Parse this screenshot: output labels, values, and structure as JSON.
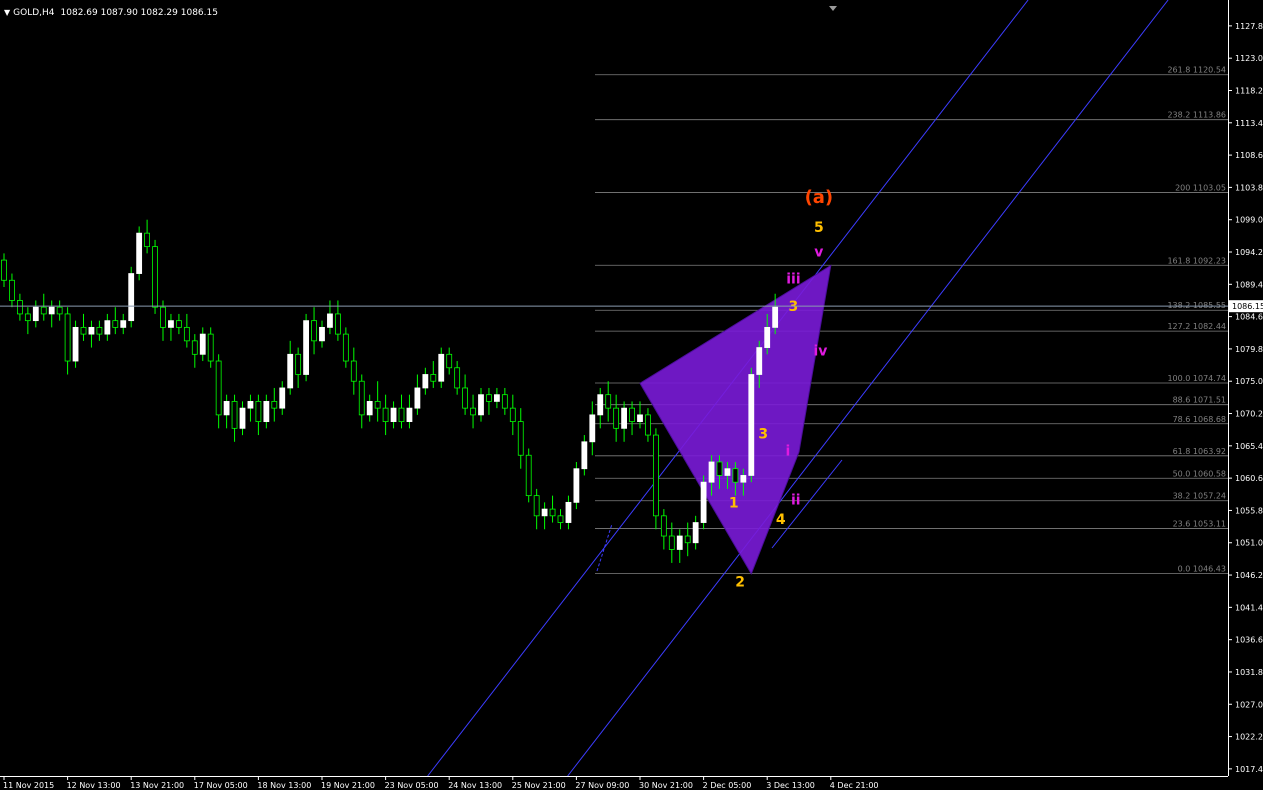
{
  "window": {
    "symbol_timeframe": "GOLD,H4",
    "ohlc": "1082.69 1087.90 1082.29 1086.15"
  },
  "colors": {
    "background": "#000000",
    "bull": "#ffffff",
    "wick_bull": "#00ff00",
    "bear": "#000000",
    "axis": "#ffffff",
    "grid_fib": "#808080",
    "channel": "#3c3cff",
    "pattern_fill": "#7a1bd8",
    "label_orange": "#ffbf00",
    "label_magenta": "#e01be0",
    "label_red": "#ff4500"
  },
  "chart_data": {
    "type": "candlestick",
    "ylim": [
      1015,
      1130
    ],
    "price_ticks": [
      1127.8,
      1123.0,
      1118.2,
      1113.4,
      1108.6,
      1103.8,
      1099.0,
      1094.2,
      1089.4,
      1084.6,
      1079.8,
      1075.0,
      1070.2,
      1065.4,
      1060.6,
      1055.8,
      1051.0,
      1046.2,
      1041.4,
      1036.6,
      1031.8,
      1027.0,
      1022.2,
      1017.4
    ],
    "price_tick_labels": [
      "1127.80",
      "1123.00",
      "1118.20",
      "1113.40",
      "1108.60",
      "1103.80",
      "1099.00",
      "1094.20",
      "1089.40",
      "1084.60",
      "1079.80",
      "1075.00",
      "1070.20",
      "1065.40",
      "1060.60",
      "1055.80",
      "1051.00",
      "1046.20",
      "1041.40",
      "1036.60",
      "1031.80",
      "1027.00",
      "1022.20",
      "1017.40"
    ],
    "current_price": 1086.15,
    "current_price_label": "1086.15",
    "time_labels": [
      "11 Nov 2015",
      "12 Nov 13:00",
      "13 Nov 21:00",
      "17 Nov 05:00",
      "18 Nov 13:00",
      "19 Nov 21:00",
      "23 Nov 05:00",
      "24 Nov 13:00",
      "25 Nov 21:00",
      "27 Nov 09:00",
      "30 Nov 21:00",
      "2 Dec 05:00",
      "3 Dec 13:00",
      "4 Dec 21:00"
    ],
    "time_label_index": [
      0,
      8,
      16,
      24,
      32,
      40,
      48,
      56,
      64,
      72,
      80,
      88,
      96,
      104
    ],
    "candles": [
      [
        1093,
        1094,
        1089,
        1090
      ],
      [
        1090,
        1091,
        1086,
        1087
      ],
      [
        1087,
        1088,
        1084,
        1085
      ],
      [
        1085,
        1086,
        1082,
        1084
      ],
      [
        1084,
        1087,
        1083,
        1086
      ],
      [
        1086,
        1088,
        1084,
        1085
      ],
      [
        1085,
        1087,
        1083,
        1086
      ],
      [
        1086,
        1087,
        1084,
        1085
      ],
      [
        1085,
        1086,
        1076,
        1078
      ],
      [
        1078,
        1084,
        1077,
        1083
      ],
      [
        1083,
        1085,
        1081,
        1082
      ],
      [
        1082,
        1084,
        1080,
        1083
      ],
      [
        1083,
        1084,
        1081,
        1082
      ],
      [
        1082,
        1085,
        1081,
        1084
      ],
      [
        1084,
        1086,
        1082,
        1083
      ],
      [
        1083,
        1085,
        1082,
        1084
      ],
      [
        1084,
        1092,
        1083,
        1091
      ],
      [
        1091,
        1098,
        1090,
        1097
      ],
      [
        1097,
        1099,
        1094,
        1095
      ],
      [
        1095,
        1096,
        1085,
        1086
      ],
      [
        1086,
        1087,
        1081,
        1083
      ],
      [
        1083,
        1085,
        1081,
        1084
      ],
      [
        1084,
        1085,
        1082,
        1083
      ],
      [
        1083,
        1085,
        1080,
        1081
      ],
      [
        1081,
        1082,
        1077,
        1079
      ],
      [
        1079,
        1083,
        1078,
        1082
      ],
      [
        1082,
        1083,
        1077,
        1078
      ],
      [
        1078,
        1079,
        1068,
        1070
      ],
      [
        1070,
        1073,
        1068,
        1072
      ],
      [
        1072,
        1073,
        1066,
        1068
      ],
      [
        1068,
        1072,
        1067,
        1071
      ],
      [
        1071,
        1073,
        1069,
        1072
      ],
      [
        1072,
        1073,
        1067,
        1069
      ],
      [
        1069,
        1073,
        1068,
        1072
      ],
      [
        1072,
        1074,
        1069,
        1071
      ],
      [
        1071,
        1075,
        1070,
        1074
      ],
      [
        1074,
        1081,
        1073,
        1079
      ],
      [
        1079,
        1080,
        1074,
        1076
      ],
      [
        1076,
        1085,
        1075,
        1084
      ],
      [
        1084,
        1086,
        1079,
        1081
      ],
      [
        1081,
        1084,
        1080,
        1083
      ],
      [
        1083,
        1087,
        1082,
        1085
      ],
      [
        1085,
        1087,
        1081,
        1082
      ],
      [
        1082,
        1083,
        1077,
        1078
      ],
      [
        1078,
        1080,
        1073,
        1075
      ],
      [
        1075,
        1076,
        1068,
        1070
      ],
      [
        1070,
        1073,
        1069,
        1072
      ],
      [
        1072,
        1075,
        1069,
        1071
      ],
      [
        1071,
        1073,
        1067,
        1069
      ],
      [
        1069,
        1072,
        1068,
        1071
      ],
      [
        1071,
        1073,
        1068,
        1069
      ],
      [
        1069,
        1073,
        1068,
        1071
      ],
      [
        1071,
        1076,
        1070,
        1074
      ],
      [
        1074,
        1077,
        1073,
        1076
      ],
      [
        1076,
        1078,
        1074,
        1075
      ],
      [
        1075,
        1080,
        1074,
        1079
      ],
      [
        1079,
        1080,
        1076,
        1077
      ],
      [
        1077,
        1078,
        1073,
        1074
      ],
      [
        1074,
        1076,
        1070,
        1071
      ],
      [
        1071,
        1073,
        1068,
        1070
      ],
      [
        1070,
        1074,
        1069,
        1073
      ],
      [
        1073,
        1074,
        1070,
        1072
      ],
      [
        1072,
        1074,
        1071,
        1073
      ],
      [
        1073,
        1074,
        1070,
        1071
      ],
      [
        1071,
        1073,
        1067,
        1069
      ],
      [
        1069,
        1071,
        1062,
        1064
      ],
      [
        1064,
        1065,
        1057,
        1058
      ],
      [
        1058,
        1059,
        1053,
        1055
      ],
      [
        1055,
        1057,
        1053,
        1056
      ],
      [
        1056,
        1058,
        1054,
        1055
      ],
      [
        1055,
        1056,
        1053,
        1054
      ],
      [
        1054,
        1058,
        1053,
        1057
      ],
      [
        1057,
        1063,
        1056,
        1062
      ],
      [
        1062,
        1067,
        1061,
        1066
      ],
      [
        1066,
        1072,
        1064,
        1070
      ],
      [
        1070,
        1074,
        1068,
        1073
      ],
      [
        1073,
        1075,
        1069,
        1071
      ],
      [
        1071,
        1073,
        1066,
        1068
      ],
      [
        1068,
        1072,
        1066,
        1071
      ],
      [
        1071,
        1072,
        1067,
        1069
      ],
      [
        1069,
        1072,
        1068,
        1070
      ],
      [
        1070,
        1071,
        1066,
        1067
      ],
      [
        1067,
        1068,
        1053,
        1055
      ],
      [
        1055,
        1056,
        1050,
        1052
      ],
      [
        1052,
        1054,
        1048,
        1050
      ],
      [
        1050,
        1053,
        1048,
        1052
      ],
      [
        1052,
        1054,
        1049,
        1051
      ],
      [
        1051,
        1055,
        1050,
        1054
      ],
      [
        1054,
        1061,
        1053,
        1060
      ],
      [
        1060,
        1064,
        1058,
        1063
      ],
      [
        1063,
        1064,
        1059,
        1061
      ],
      [
        1061,
        1063,
        1059,
        1062
      ],
      [
        1062,
        1063,
        1058,
        1060
      ],
      [
        1060,
        1062,
        1058,
        1061
      ],
      [
        1061,
        1077,
        1060,
        1076
      ],
      [
        1076,
        1081,
        1074,
        1080
      ],
      [
        1080,
        1085,
        1079,
        1083
      ],
      [
        1083,
        1088,
        1082,
        1086
      ]
    ],
    "fib_levels": [
      {
        "ratio": "261.8",
        "price": 1120.54
      },
      {
        "ratio": "238.2",
        "price": 1113.86
      },
      {
        "ratio": "200",
        "price": 1103.05
      },
      {
        "ratio": "161.8",
        "price": 1092.23
      },
      {
        "ratio": "138.2",
        "price": 1085.55
      },
      {
        "ratio": "127.2",
        "price": 1082.44
      },
      {
        "ratio": "100.0",
        "price": 1074.74
      },
      {
        "ratio": "88.6",
        "price": 1071.51
      },
      {
        "ratio": "78.6",
        "price": 1068.68
      },
      {
        "ratio": "61.8",
        "price": 1063.92
      },
      {
        "ratio": "50.0",
        "price": 1060.58
      },
      {
        "ratio": "38.2",
        "price": 1057.24
      },
      {
        "ratio": "23.6",
        "price": 1053.11
      },
      {
        "ratio": "0.0",
        "price": 1046.43
      }
    ],
    "channel": {
      "line1": [
        [
          73,
          1046.43
        ],
        [
          103,
          1092.23
        ]
      ],
      "offset_price": -18
    },
    "pattern": [
      [
        80,
        1074.7
      ],
      [
        94,
        1046.4
      ],
      [
        100,
        1064.5
      ],
      [
        104,
        1092.2
      ]
    ],
    "wave_labels": [
      {
        "text": "(a)",
        "bar": 102.5,
        "price": 1101.5,
        "color": "red"
      },
      {
        "text": "5",
        "bar": 102.5,
        "price": 1097.2,
        "color": "orange"
      },
      {
        "text": "v",
        "bar": 102.5,
        "price": 1093.5,
        "color": "magenta"
      },
      {
        "text": "iii",
        "bar": 99.3,
        "price": 1089.5,
        "color": "magenta"
      },
      {
        "text": "3",
        "bar": 99.3,
        "price": 1085.4,
        "color": "orange"
      },
      {
        "text": "iv",
        "bar": 102.7,
        "price": 1078.8,
        "color": "magenta"
      },
      {
        "text": "3",
        "bar": 95.5,
        "price": 1066.5,
        "color": "orange"
      },
      {
        "text": "i",
        "bar": 98.6,
        "price": 1064.0,
        "color": "magenta"
      },
      {
        "text": "1",
        "bar": 91.8,
        "price": 1056.2,
        "color": "orange"
      },
      {
        "text": "ii",
        "bar": 99.6,
        "price": 1056.7,
        "color": "magenta"
      },
      {
        "text": "4",
        "bar": 97.7,
        "price": 1053.8,
        "color": "orange"
      },
      {
        "text": "2",
        "bar": 92.6,
        "price": 1044.5,
        "color": "orange"
      }
    ]
  }
}
